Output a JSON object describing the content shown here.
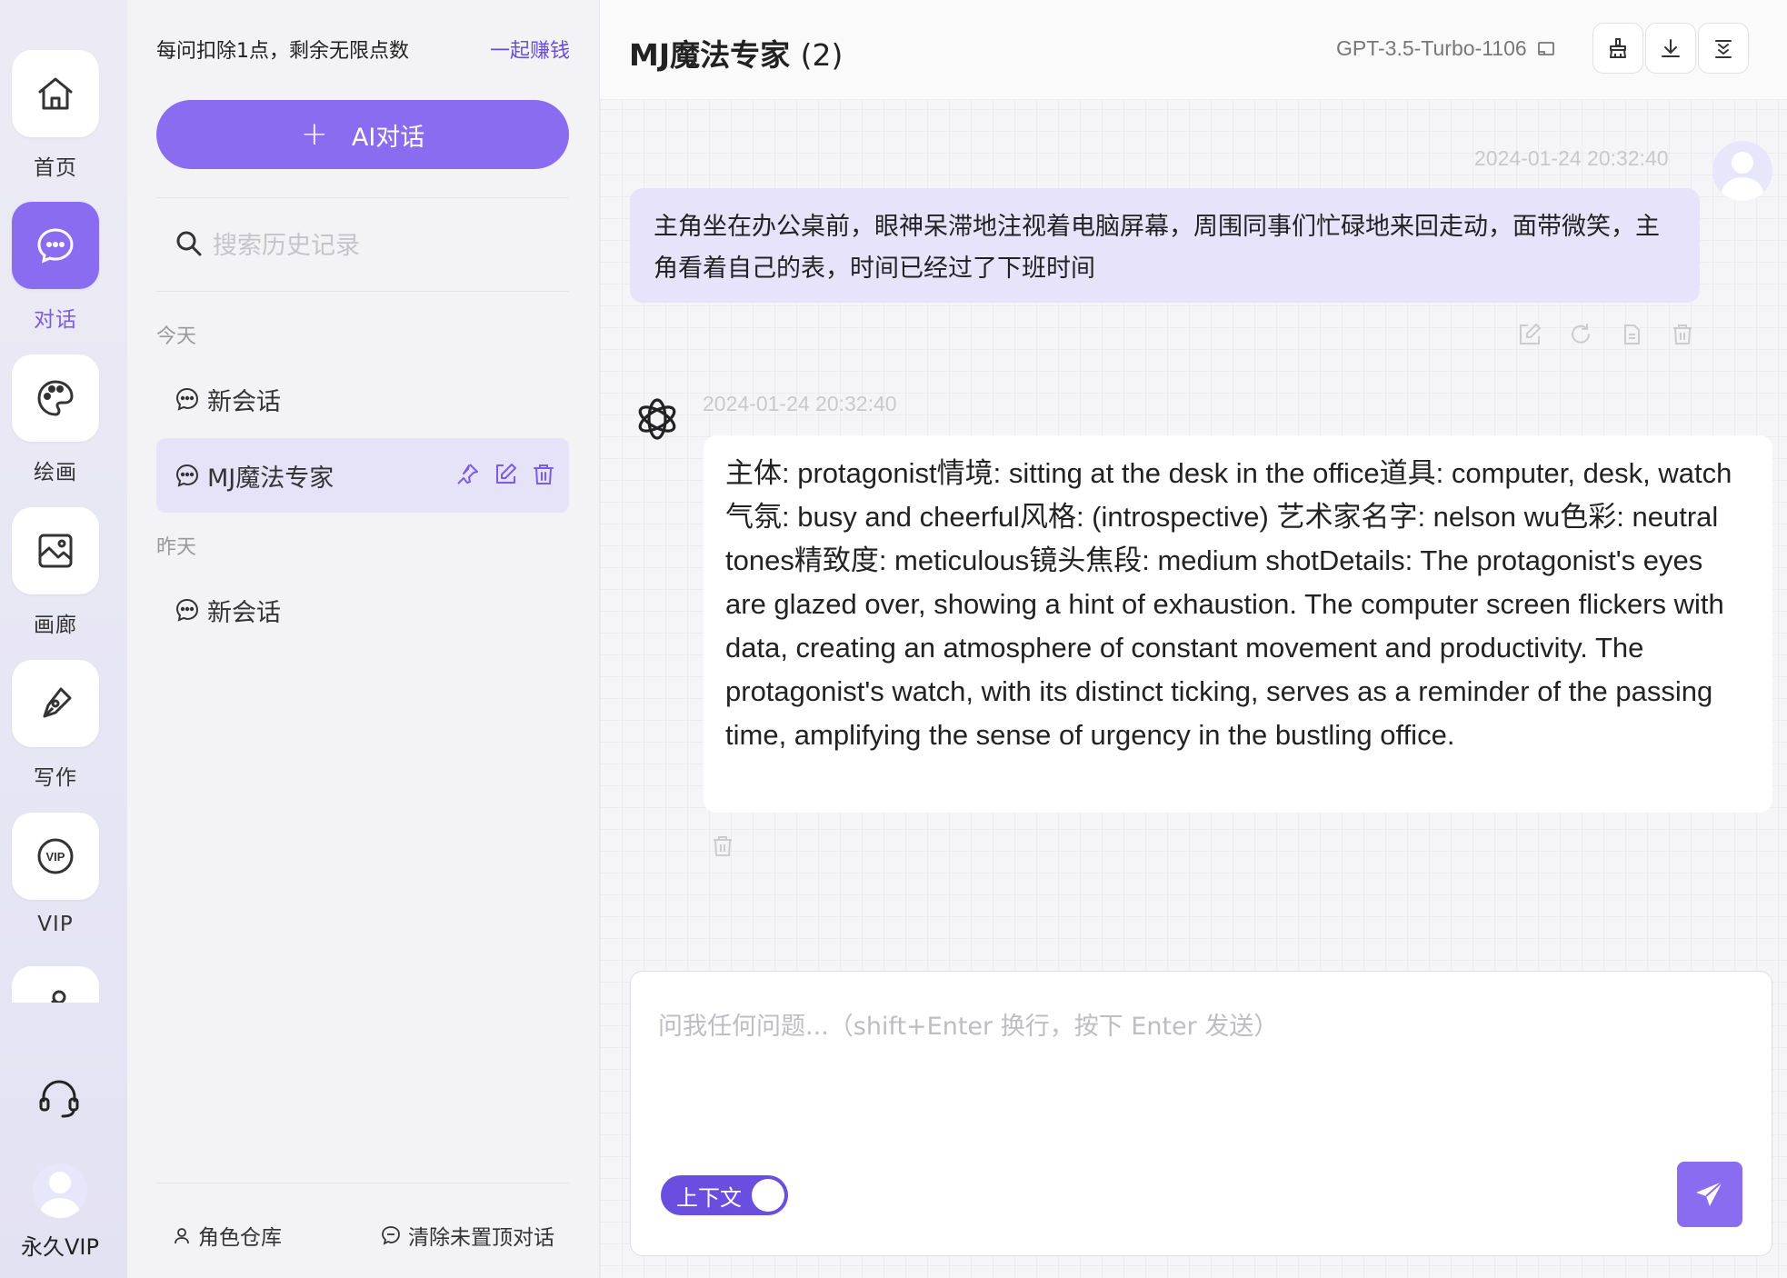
{
  "rail": {
    "items": [
      {
        "label": "首页",
        "icon": "home-icon"
      },
      {
        "label": "对话",
        "icon": "chat-icon",
        "active": true
      },
      {
        "label": "绘画",
        "icon": "palette-icon"
      },
      {
        "label": "画廊",
        "icon": "gallery-icon"
      },
      {
        "label": "写作",
        "icon": "pen-icon"
      },
      {
        "label": "VIP",
        "icon": "vip-icon"
      }
    ],
    "user_label": "永久VIP"
  },
  "sidebar": {
    "points_text": "每问扣除1点，剩余无限点数",
    "earn_link": "一起赚钱",
    "new_chat_label": "AI对话",
    "search_placeholder": "搜索历史记录",
    "groups": {
      "today": "今天",
      "yesterday": "昨天"
    },
    "conversations": [
      {
        "title": "新会话"
      },
      {
        "title": "MJ魔法专家",
        "active": true
      },
      {
        "title": "新会话"
      }
    ],
    "bottom": {
      "roles": "角色仓库",
      "clear": "清除未置顶对话"
    }
  },
  "chat": {
    "title": "MJ魔法专家",
    "count": "(2)",
    "model": "GPT-3.5-Turbo-1106",
    "messages": {
      "user": {
        "timestamp": "2024-01-24 20:32:40",
        "text": "主角坐在办公桌前，眼神呆滞地注视着电脑屏幕，周围同事们忙碌地来回走动，面带微笑，主角看着自己的表，时间已经过了下班时间"
      },
      "bot": {
        "timestamp": "2024-01-24 20:32:40",
        "text": "主体: protagonist情境: sitting at the desk in the office道具: computer, desk, watch气氛: busy and cheerful风格: (introspective) 艺术家名字: nelson wu色彩: neutral tones精致度: meticulous镜头焦段: medium shotDetails: The protagonist's eyes are glazed over, showing a hint of exhaustion. The computer screen flickers with data, creating an atmosphere of constant movement and productivity. The protagonist's watch, with its distinct ticking, serves as a reminder of the passing time, amplifying the sense of urgency in the bustling office."
      }
    },
    "input_placeholder": "问我任何问题...（shift+Enter 换行，按下 Enter 发送）",
    "context_toggle": "上下文"
  },
  "colors": {
    "accent": "#8a6cf0",
    "accent_dark": "#6a4ee0",
    "user_bubble": "#e7e3fb"
  }
}
